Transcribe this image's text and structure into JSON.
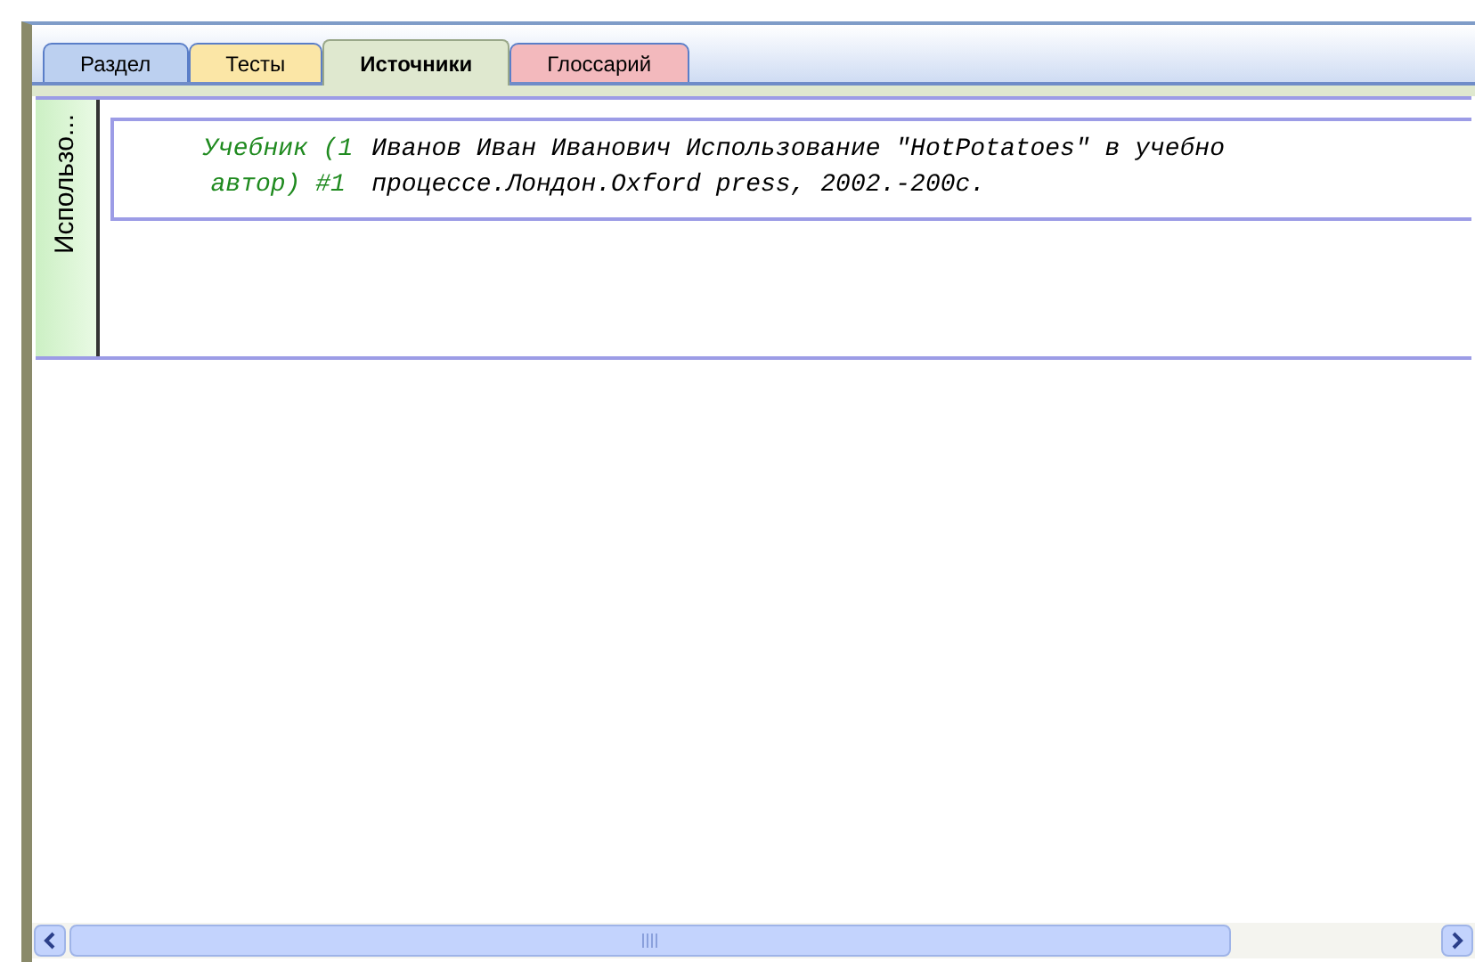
{
  "tabs": [
    {
      "label": "Раздел",
      "selected": false,
      "color": "#bcd0f0"
    },
    {
      "label": "Тесты",
      "selected": false,
      "color": "#fbe6a6"
    },
    {
      "label": "Источники",
      "selected": true,
      "color": "#dfe8cf"
    },
    {
      "label": "Глоссарий",
      "selected": false,
      "color": "#f3b9bd"
    }
  ],
  "group": {
    "label": "Использо...",
    "sources": [
      {
        "type_label": "Учебник (1 автор) #1",
        "citation_lines": [
          "Иванов Иван Иванович Использование \"HotPotatoes\" в учебно",
          "процессе.Лондон.Oxford press, 2002.-200с."
        ]
      }
    ]
  }
}
